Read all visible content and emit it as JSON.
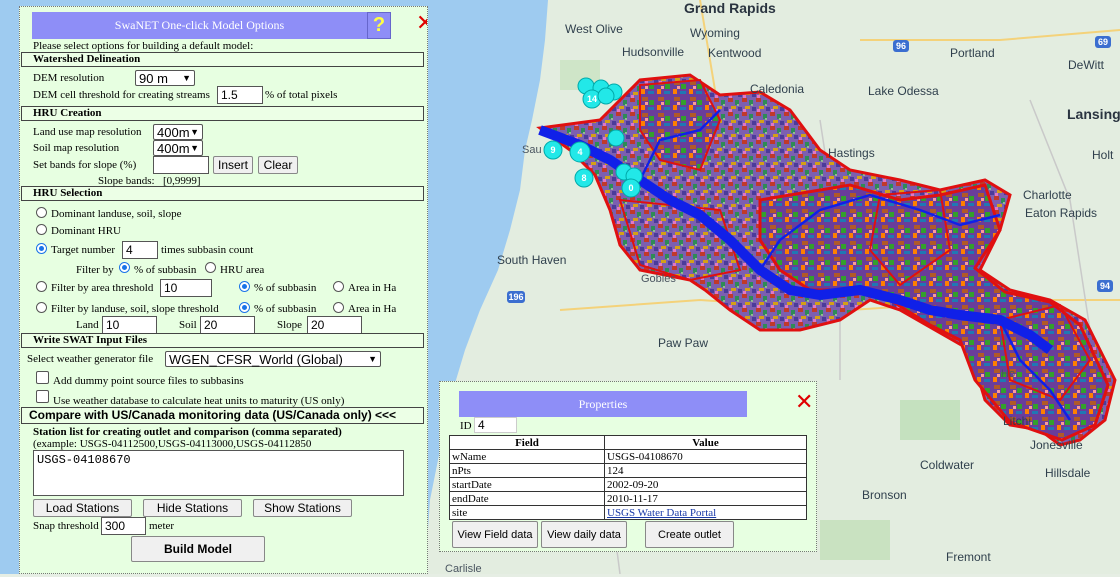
{
  "map": {
    "labels": {
      "west_olive": "West Olive",
      "grand_rapids": "Grand Rapids",
      "wyoming": "Wyoming",
      "hudsonville": "Hudsonville",
      "kentwood": "Kentwood",
      "portland": "Portland",
      "dewitt": "DeWitt",
      "caledonia": "Caledonia",
      "lake_odessa": "Lake Odessa",
      "lansing": "Lansing",
      "hastings": "Hastings",
      "holt": "Holt",
      "charlotte": "Charlotte",
      "eaton_rapids": "Eaton Rapids",
      "south_haven": "South Haven",
      "gobles": "Gobles",
      "paw_paw": "Paw Paw",
      "litchi": "Litchi",
      "jonesville": "Jonesville",
      "coldwater": "Coldwater",
      "hillsdale": "Hillsdale",
      "bronson": "Bronson",
      "fremont": "Fremont",
      "carlisle": "Carlisle",
      "hwy_96": "96",
      "hwy_69": "69",
      "hwy_196": "196",
      "hwy_94": "94",
      "ho": "Ho",
      "sau": "Sau"
    },
    "markers": [
      "14",
      "9",
      "4",
      "8",
      "0",
      "0"
    ]
  },
  "options_panel": {
    "title": "SwaNET One-click Model Options",
    "help_label": "?",
    "close_label": "✕",
    "intro": "Please select options for building a default model:",
    "watershed": {
      "header": "Watershed Delineation",
      "dem_label": "DEM resolution",
      "dem_value": "90 m",
      "threshold_label": "DEM cell threshold for creating streams",
      "threshold_value": "1.5",
      "threshold_unit": "% of total pixels"
    },
    "hru_creation": {
      "header": "HRU Creation",
      "landuse_label": "Land use map resolution",
      "landuse_value": "400m",
      "soil_label": "Soil map resolution",
      "soil_value": "400m",
      "slope_label": "Set bands for slope (%)",
      "slope_value": "",
      "insert_label": "Insert",
      "clear_label": "Clear",
      "slope_bands_label": "Slope bands:",
      "slope_bands_value": "[0,9999]"
    },
    "hru_selection": {
      "header": "HRU Selection",
      "opt_dominant_lss": "Dominant landuse, soil, slope",
      "opt_dominant_hru": "Dominant HRU",
      "opt_target": "Target number",
      "target_value": "4",
      "target_suffix": "times subbasin count",
      "filter_by": "Filter by",
      "pct_subbasin": "% of subbasin",
      "hru_area": "HRU area",
      "opt_area_threshold": "Filter by area threshold",
      "area_threshold_value": "10",
      "area_in_ha": "Area in Ha",
      "opt_lss_threshold": "Filter by landuse, soil, slope threshold",
      "land_label": "Land",
      "land_value": "10",
      "soil_label": "Soil",
      "soil_value": "20",
      "slope_label": "Slope",
      "slope_value": "20"
    },
    "swat_input": {
      "header": "Write SWAT Input Files",
      "weather_label": "Select weather generator file",
      "weather_value": "WGEN_CFSR_World (Global)",
      "dummy_label": "Add dummy point source files to subbasins",
      "heat_label": "Use weather database to calculate heat units to maturity (US only)"
    },
    "compare": {
      "header": "Compare with US/Canada monitoring data (US/Canada only) <<<",
      "station_label": "Station list for creating outlet and comparison (comma separated)",
      "example": "(example: USGS-04112500,USGS-04113000,USGS-04112850",
      "station_value": "USGS-04108670",
      "load_label": "Load Stations",
      "hide_label": "Hide Stations",
      "show_label": "Show Stations",
      "snap_label": "Snap threshold",
      "snap_value": "300",
      "snap_unit": "meter"
    },
    "build_label": "Build Model"
  },
  "properties_panel": {
    "title": "Properties",
    "close_label": "✕",
    "id_label": "ID",
    "id_value": "4",
    "col_field": "Field",
    "col_value": "Value",
    "rows": [
      {
        "field": "wName",
        "value": "USGS-04108670"
      },
      {
        "field": "nPts",
        "value": "124"
      },
      {
        "field": "startDate",
        "value": "2002-09-20"
      },
      {
        "field": "endDate",
        "value": "2010-11-17"
      },
      {
        "field": "site",
        "value": "USGS Water Data Portal"
      }
    ],
    "view_field_label": "View Field data",
    "view_daily_label": "View daily data",
    "create_outlet_label": "Create outlet"
  },
  "colors": {
    "accent": "#8e8ef7",
    "panel_bg": "#e7ffe1",
    "close": "#e00000",
    "watershed_border": "#e01010",
    "river": "#1020e8"
  }
}
